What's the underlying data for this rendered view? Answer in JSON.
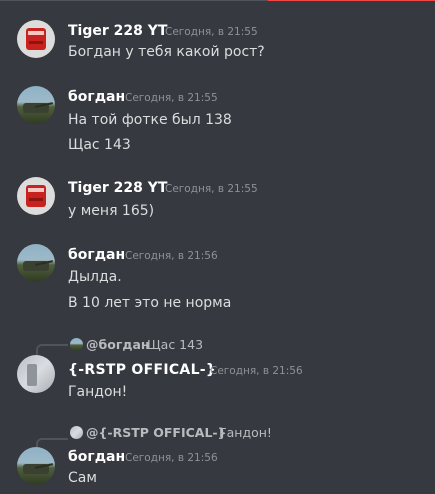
{
  "messages": [
    {
      "author": "Tiger 228 YT",
      "timestamp": "Сегодня, в 21:55",
      "lines": [
        "Богдан у тебя какой рост?"
      ]
    },
    {
      "author": "богдан",
      "timestamp": "Сегодня, в 21:55",
      "lines": [
        "На той фотке был 138",
        "Щас 143"
      ]
    },
    {
      "author": "Tiger 228 YT",
      "timestamp": "Сегодня, в 21:55",
      "lines": [
        "у меня 165)"
      ]
    },
    {
      "author": "богдан",
      "timestamp": "Сегодня, в 21:56",
      "lines": [
        "Дылда.",
        "В 10 лет это не норма"
      ]
    },
    {
      "reply": {
        "mention": "@богдан",
        "text": "Щас 143"
      },
      "author": "{-RSTP OFFICAL-}",
      "timestamp": "Сегодня, в 21:56",
      "lines": [
        "Гандон!"
      ]
    },
    {
      "reply": {
        "mention": "@{-RSTP OFFICAL-}",
        "text": "Гандон!"
      },
      "author": "богдан",
      "timestamp": "Сегодня, в 21:56",
      "lines": [
        "Сам"
      ]
    }
  ],
  "colors": {
    "background": "#36393f",
    "username": "#ffffff",
    "text": "#dcddde",
    "timestamp": "#8e9297",
    "new_messages_line": "#f04747"
  }
}
